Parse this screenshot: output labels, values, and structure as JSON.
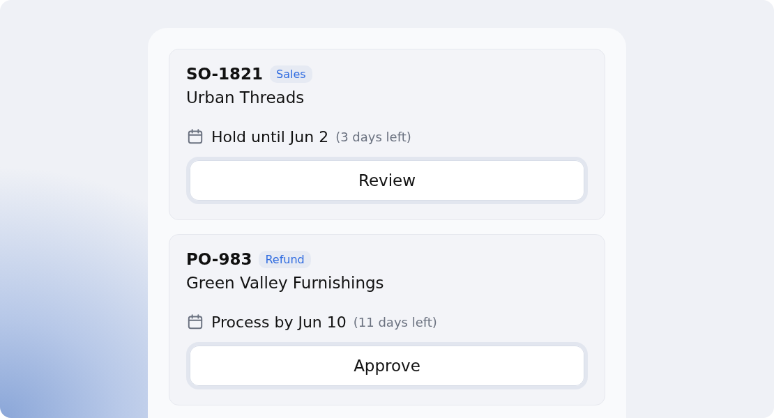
{
  "orders": [
    {
      "number": "SO-1821",
      "tag": "Sales",
      "customer": "Urban Threads",
      "due": "Hold until Jun 2",
      "remaining": "(3 days left)",
      "action": "Review"
    },
    {
      "number": "PO-983",
      "tag": "Refund",
      "customer": "Green Valley Furnishings",
      "due": "Process by Jun 10",
      "remaining": "(11 days left)",
      "action": "Approve"
    }
  ]
}
